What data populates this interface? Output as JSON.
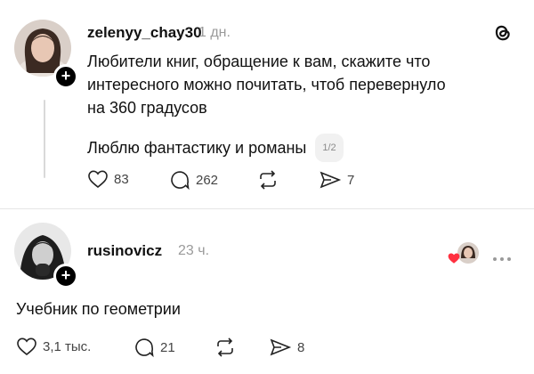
{
  "post": {
    "username": "zelenyy_chay30",
    "time": "1 дн.",
    "text_lines": [
      "Любители книг, обращение к вам, скажите что",
      "интересного можно почитать, чтоб перевернуло",
      "на 360 градусов"
    ],
    "continuation": "Люблю фантастику и романы",
    "page_indicator": "1/2",
    "likes": "83",
    "comments": "262",
    "shares": "7",
    "app_logo_icon": "threads-logo-icon"
  },
  "reply": {
    "username": "rusinovicz",
    "time": "23 ч.",
    "text": "Учебник по геометрии",
    "likes": "3,1 тыс.",
    "comments": "21",
    "shares": "8"
  },
  "colors": {
    "muted": "#9a9a9a",
    "heart_red": "#ff3040"
  }
}
